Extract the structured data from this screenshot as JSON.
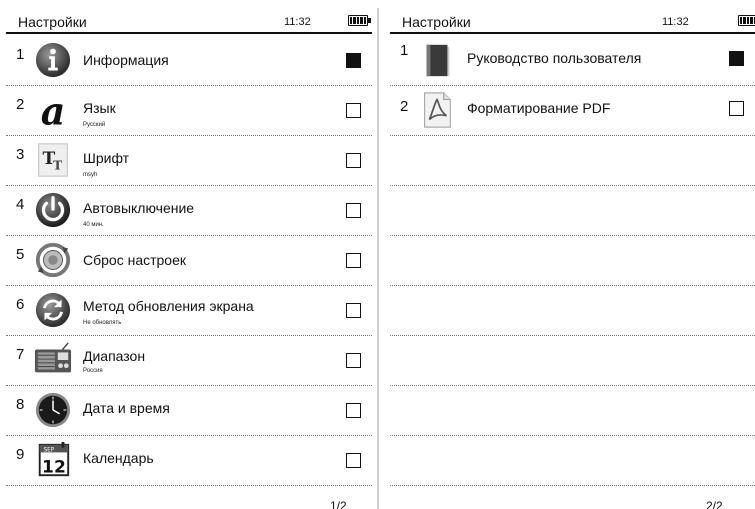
{
  "left": {
    "title": "Настройки",
    "time": "11:32",
    "page": "1/2",
    "items": [
      {
        "num": "1",
        "label": "Информация",
        "sub": "",
        "icon": "info-icon",
        "checked": true
      },
      {
        "num": "2",
        "label": "Язык",
        "sub": "Русский",
        "icon": "language-icon",
        "checked": false
      },
      {
        "num": "3",
        "label": "Шрифт",
        "sub": "msyh",
        "icon": "font-icon",
        "checked": false
      },
      {
        "num": "4",
        "label": "Автовыключение",
        "sub": "40 мин.",
        "icon": "power-icon",
        "checked": false
      },
      {
        "num": "5",
        "label": "Сброс настроек",
        "sub": "",
        "icon": "reset-icon",
        "checked": false
      },
      {
        "num": "6",
        "label": "Метод обновления экрана",
        "sub": "Не обновлять",
        "icon": "refresh-icon",
        "checked": false
      },
      {
        "num": "7",
        "label": "Диапазон",
        "sub": "Россия",
        "icon": "radio-icon",
        "checked": false
      },
      {
        "num": "8",
        "label": "Дата и время",
        "sub": "",
        "icon": "clock-icon",
        "checked": false
      },
      {
        "num": "9",
        "label": "Календарь",
        "sub": "",
        "icon": "calendar-icon",
        "checked": false
      }
    ],
    "calendar_icon_text": {
      "month": "SEP",
      "day": "12"
    }
  },
  "right": {
    "title": "Настройки",
    "time": "11:32",
    "page": "2/2",
    "items": [
      {
        "num": "1",
        "label": "Руководство пользователя",
        "icon": "manual-icon",
        "checked": true
      },
      {
        "num": "2",
        "label": "Форматирование PDF",
        "icon": "pdf-icon",
        "checked": false
      }
    ]
  }
}
